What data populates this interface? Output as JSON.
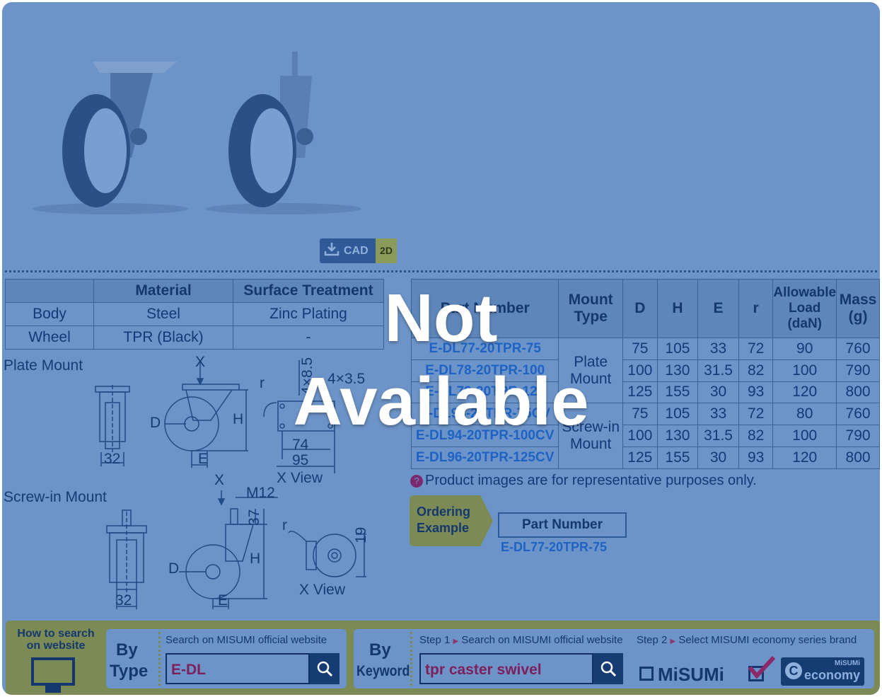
{
  "cad": {
    "label": "CAD",
    "mode": "2D"
  },
  "material_table": {
    "headers": [
      "",
      "Material",
      "Surface Treatment"
    ],
    "rows": [
      [
        "Body",
        "Steel",
        "Zinc Plating"
      ],
      [
        "Wheel",
        "TPR (Black)",
        "-"
      ]
    ]
  },
  "diagrams": {
    "plate_mount_title": "Plate Mount",
    "screw_mount_title": "Screw-in Mount",
    "plate": {
      "x": "X",
      "d": "D",
      "h": "H",
      "e": "E",
      "r": "r",
      "w32": "32",
      "w74": "74",
      "w95": "95",
      "view": "X View",
      "holes": "4×3.5",
      "slot": "4×8.5"
    },
    "screw": {
      "x": "X",
      "m12": "M12",
      "d37": "37",
      "d": "D",
      "h": "H",
      "e": "E",
      "r": "r",
      "w32": "32",
      "d19": "19",
      "view": "X View"
    }
  },
  "spec_table": {
    "headers": [
      "Part Number",
      "Mount Type",
      "D",
      "H",
      "E",
      "r",
      "Allowable Load (daN)",
      "Mass (g)"
    ],
    "mount_types": [
      "Plate Mount",
      "Screw-in Mount"
    ],
    "rows": [
      [
        "E-DL77-20TPR-75",
        "75",
        "105",
        "33",
        "72",
        "90",
        "760"
      ],
      [
        "E-DL78-20TPR-100",
        "100",
        "130",
        "31.5",
        "82",
        "100",
        "790"
      ],
      [
        "E-DL79-20TPR-125",
        "125",
        "155",
        "30",
        "93",
        "120",
        "800"
      ],
      [
        "E-DL93-20TPR-75CV",
        "75",
        "105",
        "33",
        "72",
        "80",
        "760"
      ],
      [
        "E-DL94-20TPR-100CV",
        "100",
        "130",
        "31.5",
        "82",
        "100",
        "790"
      ],
      [
        "E-DL96-20TPR-125CV",
        "125",
        "155",
        "30",
        "93",
        "120",
        "800"
      ]
    ]
  },
  "note": "Product images are for representative purposes only.",
  "ordering": {
    "label": "Ordering Example",
    "pn_header": "Part Number",
    "pn_value": "E-DL77-20TPR-75"
  },
  "search": {
    "howto": "How to search on website",
    "by": "By",
    "type": "Type",
    "keyword": "Keyword",
    "type_caption": "Search on MISUMI official website",
    "type_value": "E-DL",
    "step1": "Step 1",
    "step1_text": "Search on MISUMI official website",
    "step2": "Step 2",
    "step2_text": "Select MISUMI economy series brand",
    "keyword_value": "tpr caster swivel",
    "misumi": "MiSUMi",
    "eco_small": "MiSUMi",
    "eco_big": "economy"
  },
  "overlay": {
    "line1": "Not",
    "line2": "Available"
  }
}
